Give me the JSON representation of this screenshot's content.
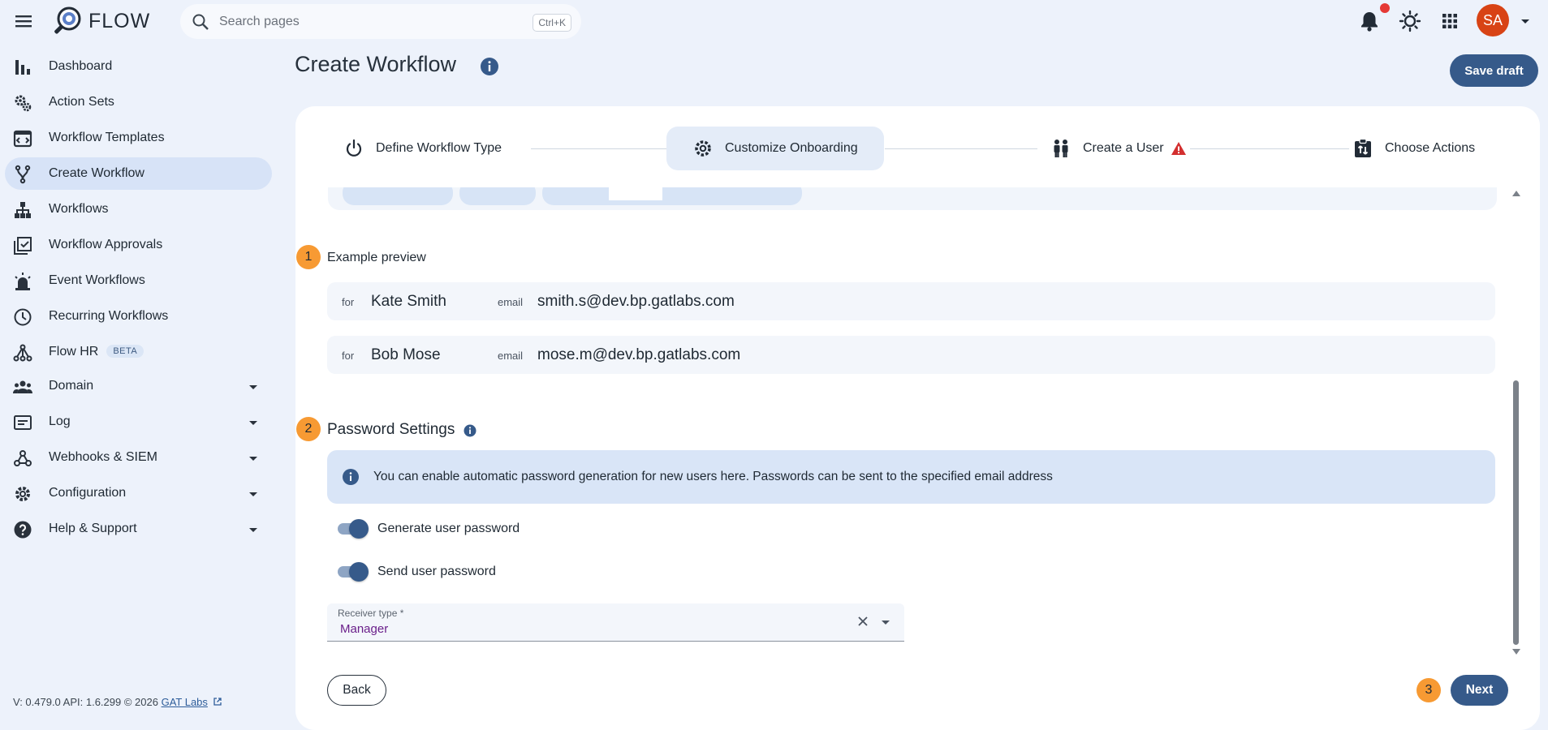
{
  "app": {
    "brand": "FLOW"
  },
  "search": {
    "placeholder": "Search pages",
    "shortcut": "Ctrl+K"
  },
  "sidebar": {
    "items": [
      {
        "label": "Dashboard"
      },
      {
        "label": "Action Sets"
      },
      {
        "label": "Workflow Templates"
      },
      {
        "label": "Create Workflow",
        "active": true
      },
      {
        "label": "Workflows"
      },
      {
        "label": "Workflow Approvals"
      },
      {
        "label": "Event Workflows"
      },
      {
        "label": "Recurring Workflows"
      },
      {
        "label": "Flow HR",
        "badge": "BETA"
      },
      {
        "label": "Domain",
        "expandable": true
      },
      {
        "label": "Log",
        "expandable": true
      },
      {
        "label": "Webhooks & SIEM",
        "expandable": true
      },
      {
        "label": "Configuration",
        "expandable": true
      },
      {
        "label": "Help & Support",
        "expandable": true
      }
    ],
    "footer": {
      "versions": "V: 0.479.0  API: 1.6.299  © 2026",
      "link": "GAT Labs"
    }
  },
  "header": {
    "title": "Create Workflow",
    "save_draft": "Save draft",
    "avatar_initials": "SA"
  },
  "stepper": {
    "steps": [
      {
        "label": "Define Workflow Type"
      },
      {
        "label": "Customize Onboarding",
        "active": true
      },
      {
        "label": "Create a User",
        "warning": true
      },
      {
        "label": "Choose Actions"
      }
    ]
  },
  "preview": {
    "number": "1",
    "label": "Example preview",
    "for_label": "for",
    "email_label": "email",
    "rows": [
      {
        "name": "Kate Smith",
        "email": "smith.s@dev.bp.gatlabs.com"
      },
      {
        "name": "Bob Mose",
        "email": "mose.m@dev.bp.gatlabs.com"
      }
    ]
  },
  "password": {
    "number": "2",
    "heading": "Password Settings",
    "info": "You can enable automatic password generation for new users here. Passwords can be sent to the specified email address",
    "toggles": [
      {
        "label": "Generate user password",
        "on": true
      },
      {
        "label": "Send user password",
        "on": true
      }
    ],
    "receiver": {
      "label": "Receiver type *",
      "value": "Manager"
    }
  },
  "footer_actions": {
    "back": "Back",
    "next": "Next",
    "next_number": "3"
  },
  "colors": {
    "primary": "#365a8a",
    "accent_orange": "#f79a33",
    "avatar": "#d84315",
    "warning": "#d32f2f"
  }
}
